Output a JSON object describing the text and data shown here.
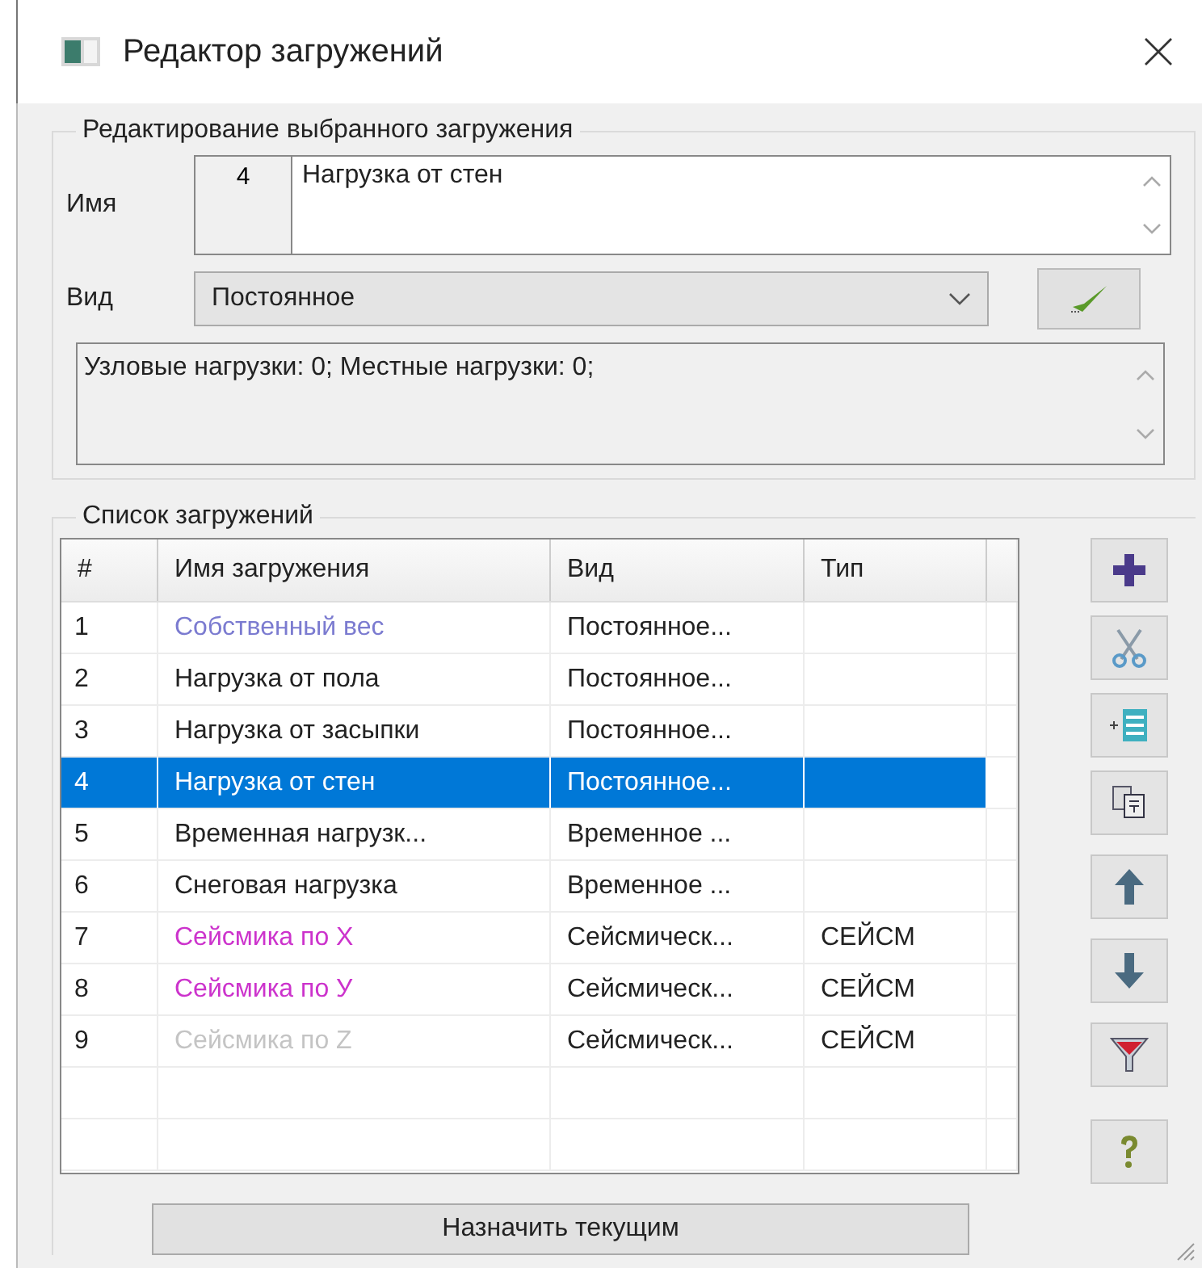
{
  "window": {
    "title": "Редактор загружений"
  },
  "edit_group": {
    "legend": "Редактирование выбранного загружения",
    "name_label": "Имя",
    "number": "4",
    "name_value": "Нагрузка от стен",
    "kind_label": "Вид",
    "kind_value": "Постоянное",
    "info": "Узловые нагрузки:  0;  Местные нагрузки:  0;"
  },
  "list_group": {
    "legend": "Список загружений",
    "columns": [
      "#",
      "Имя загружения",
      "Вид",
      "Тип"
    ],
    "rows": [
      {
        "num": "1",
        "name": "Собственный вес",
        "color": "#7b7bd0",
        "kind": "Постоянное...",
        "type": "",
        "selected": false
      },
      {
        "num": "2",
        "name": "Нагрузка от пола",
        "kind": "Постоянное...",
        "type": "",
        "selected": false
      },
      {
        "num": "3",
        "name": "Нагрузка от засыпки",
        "kind": "Постоянное...",
        "type": "",
        "selected": false
      },
      {
        "num": "4",
        "name": "Нагрузка от стен",
        "kind": "Постоянное...",
        "type": "",
        "selected": true
      },
      {
        "num": "5",
        "name": "Временная нагрузк...",
        "kind": "Временное ...",
        "type": "",
        "selected": false
      },
      {
        "num": "6",
        "name": "Снеговая нагрузка",
        "kind": "Временное ...",
        "type": "",
        "selected": false
      },
      {
        "num": "7",
        "name": "Сейсмика по X",
        "color": "#cc33cc",
        "kind": "Сейсмическ...",
        "type": "СЕЙСМ",
        "selected": false
      },
      {
        "num": "8",
        "name": "Сейсмика по У",
        "color": "#cc33cc",
        "kind": "Сейсмическ...",
        "type": "СЕЙСМ",
        "selected": false
      },
      {
        "num": "9",
        "name": "Сейсмика по Z",
        "color": "#c4c4c4",
        "kind": "Сейсмическ...",
        "type": "СЕЙСМ",
        "selected": false
      }
    ],
    "assign_button": "Назначить текущим"
  }
}
